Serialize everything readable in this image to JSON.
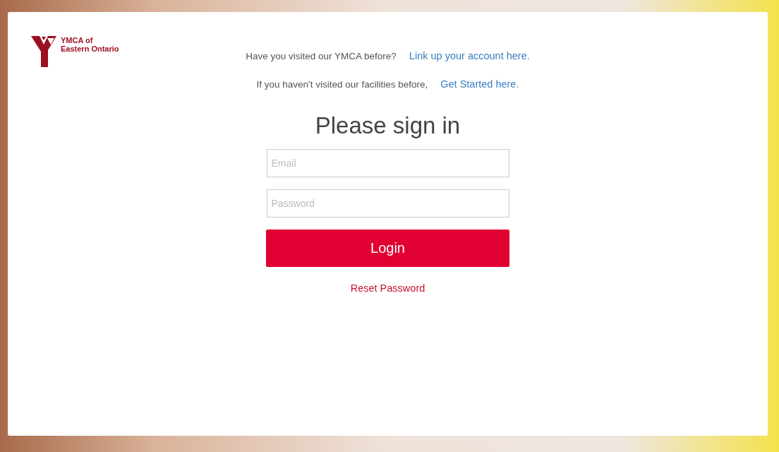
{
  "logo": {
    "line_1": "YMCA of",
    "line_2": "Eastern Ontario"
  },
  "prompts": [
    {
      "text": "Have you visited our YMCA before?",
      "link": "Link up your account here."
    },
    {
      "text": "If you haven't visited our facilities before,",
      "link": "Get Started here."
    }
  ],
  "heading": "Please sign in",
  "fields": [
    {
      "placeholder": "Email"
    },
    {
      "placeholder": "Password"
    }
  ],
  "login_button": "Login",
  "reset_link": "Reset Password"
}
